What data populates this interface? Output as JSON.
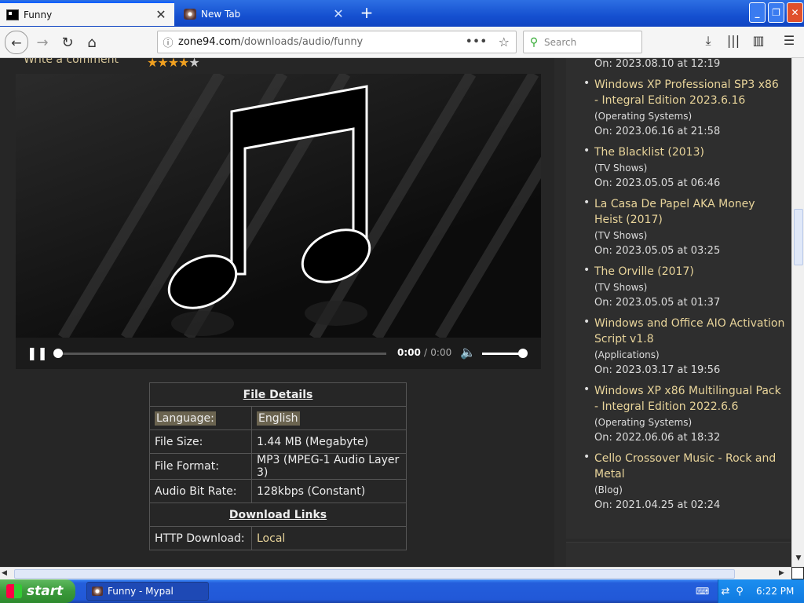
{
  "tabs": [
    {
      "label": "Funny",
      "active": true
    },
    {
      "label": "New Tab",
      "active": false
    }
  ],
  "window_buttons": {
    "minimize": "_",
    "maximize": "❐",
    "close": "✕"
  },
  "nav": {
    "url_host": "zone94.com",
    "url_path": "/downloads/audio/funny",
    "search_placeholder": "Search"
  },
  "page": {
    "comment_link": "Write a comment",
    "rating": {
      "value": 4,
      "max": 5
    }
  },
  "player": {
    "current_time": "0:00",
    "separator": "/",
    "duration": "0:00",
    "progress": 0.0,
    "volume": 1.0
  },
  "file_details": {
    "title": "File Details",
    "rows": [
      {
        "key": "Language:",
        "value": "English"
      },
      {
        "key": "File Size:",
        "value": "1.44 MB (Megabyte)"
      },
      {
        "key": "File Format:",
        "value": "MP3 (MPEG-1 Audio Layer 3)"
      },
      {
        "key": "Audio Bit Rate:",
        "value": "128kbps (Constant)"
      }
    ],
    "downloads_title": "Download Links",
    "download_key": "HTTP Download:",
    "download_value": "Local"
  },
  "sidebar": {
    "top_date": "On: 2023.08.10 at 12:19",
    "items": [
      {
        "title": "Windows XP Professional SP3 x86 - Integral Edition 2023.6.16",
        "category": "(Operating Systems)",
        "date": "On: 2023.06.16 at 21:58"
      },
      {
        "title": "The Blacklist (2013)",
        "category": "(TV Shows)",
        "date": "On: 2023.05.05 at 06:46"
      },
      {
        "title": "La Casa De Papel AKA Money Heist (2017)",
        "category": "(TV Shows)",
        "date": "On: 2023.05.05 at 03:25"
      },
      {
        "title": "The Orville (2017)",
        "category": "(TV Shows)",
        "date": "On: 2023.05.05 at 01:37"
      },
      {
        "title": "Windows and Office AIO Activation Script v1.8",
        "category": "(Applications)",
        "date": "On: 2023.03.17 at 19:56"
      },
      {
        "title": "Windows XP x86 Multilingual Pack - Integral Edition 2022.6.6",
        "category": "(Operating Systems)",
        "date": "On: 2022.06.06 at 18:32"
      },
      {
        "title": "Cello Crossover Music - Rock and Metal",
        "category": "(Blog)",
        "date": "On: 2021.04.25 at 02:24"
      }
    ]
  },
  "taskbar": {
    "start_label": "start",
    "app_label": "Funny - Mypal",
    "clock": "6:22 PM"
  },
  "colors": {
    "link_gold": "#e8d49a",
    "star": "#f0a020",
    "taskbar_blue": "#245edb",
    "start_green": "#3b9a3b"
  }
}
